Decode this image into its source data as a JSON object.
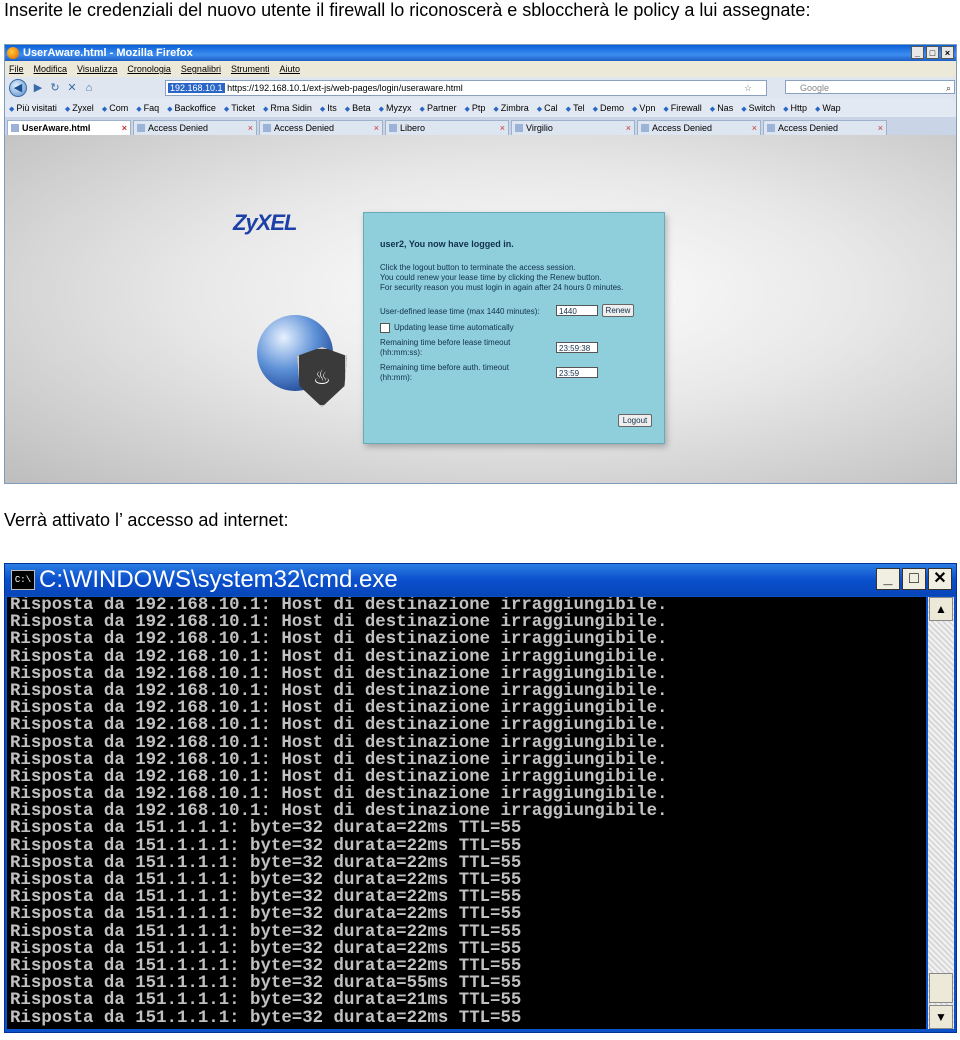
{
  "caption_top": "Inserite le credenziali del nuovo utente il firewall lo riconoscerà e sbloccherà le policy a lui assegnate:",
  "caption_middle": "Verrà attivato l’ accesso ad internet:",
  "firefox": {
    "title": "UserAware.html - Mozilla Firefox",
    "menu": [
      "File",
      "Modifica",
      "Visualizza",
      "Cronologia",
      "Segnalibri",
      "Strumenti",
      "Aiuto"
    ],
    "url_ip": "192.168.10.1",
    "url_rest": "https://192.168.10.1/ext-js/web-pages/login/useraware.html",
    "search_placeholder": "Google",
    "bookmarks": [
      "Più visitati",
      "Zyxel",
      "Com",
      "Faq",
      "Backoffice",
      "Ticket",
      "Rma Sidin",
      "Its",
      "Beta",
      "Myzyx",
      "Partner",
      "Ptp",
      "Zimbra",
      "Cal",
      "Tel",
      "Demo",
      "Vpn",
      "Firewall",
      "Nas",
      "Switch",
      "Http",
      "Wap"
    ],
    "tabs": [
      "UserAware.html",
      "Access Denied",
      "Access Denied",
      "Libero",
      "Virgilio",
      "Access Denied",
      "Access Denied"
    ],
    "page": {
      "logo": "ZyXEL",
      "login_header": "user2, You now have logged in.",
      "info_lines": [
        "Click the logout button to terminate the access session.",
        "You could renew your lease time by clicking the Renew button.",
        "For security reason you must login in again after 24 hours 0 minutes."
      ],
      "lease_label": "User-defined lease time (max 1440 minutes):",
      "lease_value": "1440",
      "renew_label": "Renew",
      "auto_label": "Updating lease time automatically",
      "remaining_lease_label_1": "Remaining time before lease timeout",
      "remaining_lease_label_2": "(hh:mm:ss):",
      "remaining_lease_value": "23:59:38",
      "remaining_auth_label_1": "Remaining time before auth. timeout",
      "remaining_auth_label_2": "(hh:mm):",
      "remaining_auth_value": "23:59",
      "logout_label": "Logout"
    }
  },
  "cmd": {
    "title": "C:\\WINDOWS\\system32\\cmd.exe",
    "icon_text": "C:\\",
    "lines": [
      "Risposta da 192.168.10.1: Host di destinazione irraggiungibile.",
      "Risposta da 192.168.10.1: Host di destinazione irraggiungibile.",
      "Risposta da 192.168.10.1: Host di destinazione irraggiungibile.",
      "Risposta da 192.168.10.1: Host di destinazione irraggiungibile.",
      "Risposta da 192.168.10.1: Host di destinazione irraggiungibile.",
      "Risposta da 192.168.10.1: Host di destinazione irraggiungibile.",
      "Risposta da 192.168.10.1: Host di destinazione irraggiungibile.",
      "Risposta da 192.168.10.1: Host di destinazione irraggiungibile.",
      "Risposta da 192.168.10.1: Host di destinazione irraggiungibile.",
      "Risposta da 192.168.10.1: Host di destinazione irraggiungibile.",
      "Risposta da 192.168.10.1: Host di destinazione irraggiungibile.",
      "Risposta da 192.168.10.1: Host di destinazione irraggiungibile.",
      "Risposta da 192.168.10.1: Host di destinazione irraggiungibile.",
      "Risposta da 151.1.1.1: byte=32 durata=22ms TTL=55",
      "Risposta da 151.1.1.1: byte=32 durata=22ms TTL=55",
      "Risposta da 151.1.1.1: byte=32 durata=22ms TTL=55",
      "Risposta da 151.1.1.1: byte=32 durata=22ms TTL=55",
      "Risposta da 151.1.1.1: byte=32 durata=22ms TTL=55",
      "Risposta da 151.1.1.1: byte=32 durata=22ms TTL=55",
      "Risposta da 151.1.1.1: byte=32 durata=22ms TTL=55",
      "Risposta da 151.1.1.1: byte=32 durata=22ms TTL=55",
      "Risposta da 151.1.1.1: byte=32 durata=22ms TTL=55",
      "Risposta da 151.1.1.1: byte=32 durata=55ms TTL=55",
      "Risposta da 151.1.1.1: byte=32 durata=21ms TTL=55",
      "Risposta da 151.1.1.1: byte=32 durata=22ms TTL=55"
    ]
  }
}
